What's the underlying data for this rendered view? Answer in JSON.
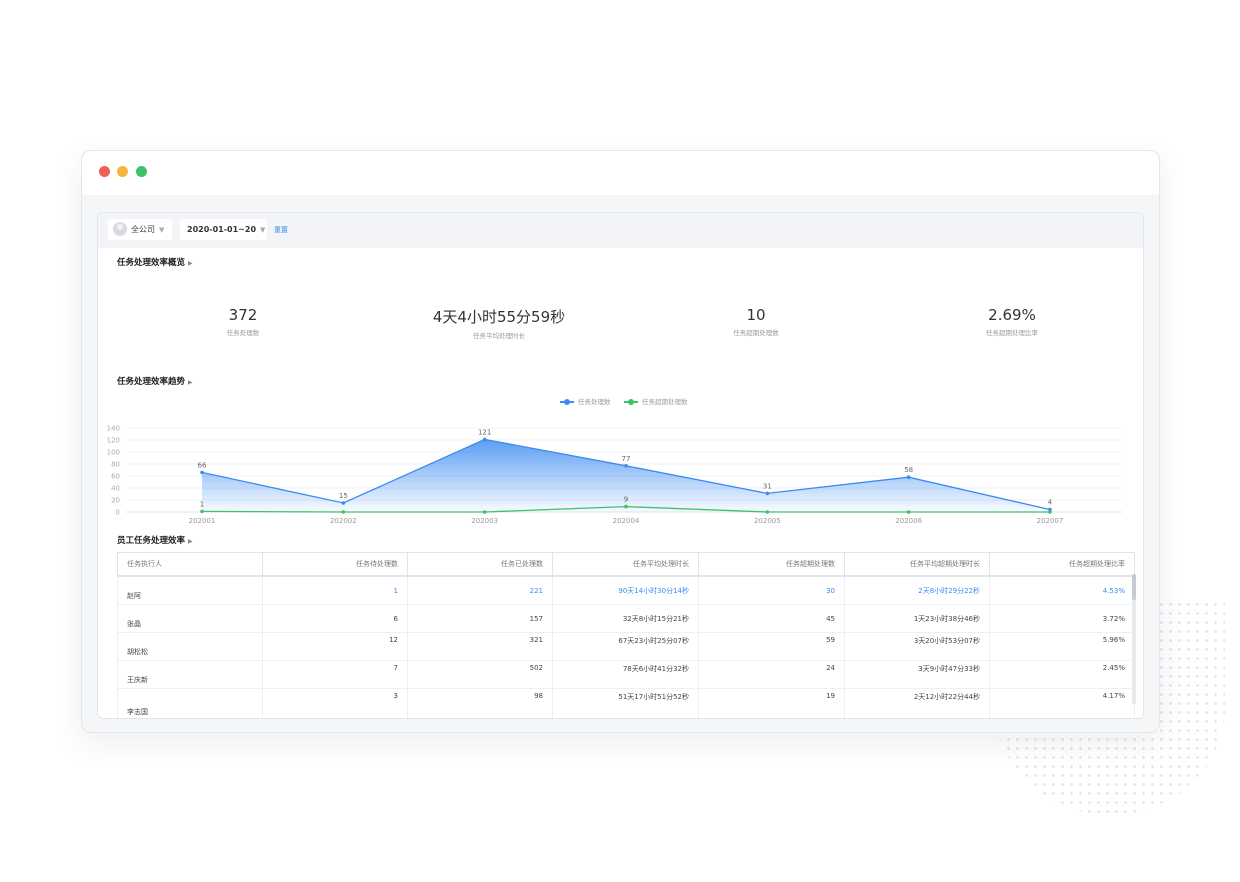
{
  "filters": {
    "company": "全公司",
    "date_range": "2020-01-01~20",
    "reset": "重置"
  },
  "overview": {
    "title": "任务处理效率概览",
    "kpis": [
      {
        "value": "372",
        "label": "任务处理数"
      },
      {
        "value": "4天4小时55分59秒",
        "label": "任务平均处理时长"
      },
      {
        "value": "10",
        "label": "任务超期处理数"
      },
      {
        "value": "2.69%",
        "label": "任务超期处理比率"
      }
    ]
  },
  "trend": {
    "title": "任务处理效率趋势",
    "colors": {
      "processed": "#3d8bf2",
      "overdue": "#3cc26a"
    }
  },
  "chart_data": {
    "type": "area",
    "categories": [
      "202001",
      "202002",
      "202003",
      "202004",
      "202005",
      "202006",
      "202007"
    ],
    "series": [
      {
        "name": "任务处理数",
        "values": [
          66,
          15,
          121,
          77,
          31,
          58,
          4
        ]
      },
      {
        "name": "任务超期处理数",
        "values": [
          1,
          0,
          0,
          9,
          0,
          0,
          0
        ]
      }
    ],
    "point_labels": [
      [
        "66",
        "15",
        "121",
        "77",
        "31",
        "58",
        "4"
      ],
      [
        "1",
        "",
        "",
        "9",
        "",
        "",
        ""
      ]
    ],
    "y_ticks": [
      "0",
      "20",
      "40",
      "60",
      "80",
      "100",
      "120",
      "140"
    ],
    "ylim": [
      0,
      140
    ],
    "legend_position": "top-center",
    "grid": true
  },
  "employees": {
    "title": "员工任务处理效率",
    "columns": [
      "任务执行人",
      "任务待处理数",
      "任务已处理数",
      "任务平均处理时长",
      "任务超期处理数",
      "任务平均超期处理时长",
      "任务超期处理比率"
    ],
    "rows": [
      [
        "赵阿",
        "1",
        "221",
        "90天14小时30分14秒",
        "30",
        "2天8小时29分22秒",
        "4.53%"
      ],
      [
        "张晶",
        "6",
        "157",
        "32天8小时15分21秒",
        "45",
        "1天23小时38分46秒",
        "3.72%"
      ],
      [
        "胡松松",
        "12",
        "321",
        "67天23小时25分07秒",
        "59",
        "3天20小时53分07秒",
        "5.96%"
      ],
      [
        "王庆新",
        "7",
        "502",
        "78天6小时41分32秒",
        "24",
        "3天9小时47分33秒",
        "2.45%"
      ],
      [
        "李志国",
        "3",
        "98",
        "51天17小时51分52秒",
        "19",
        "2天12小时22分44秒",
        "4.17%"
      ]
    ]
  }
}
